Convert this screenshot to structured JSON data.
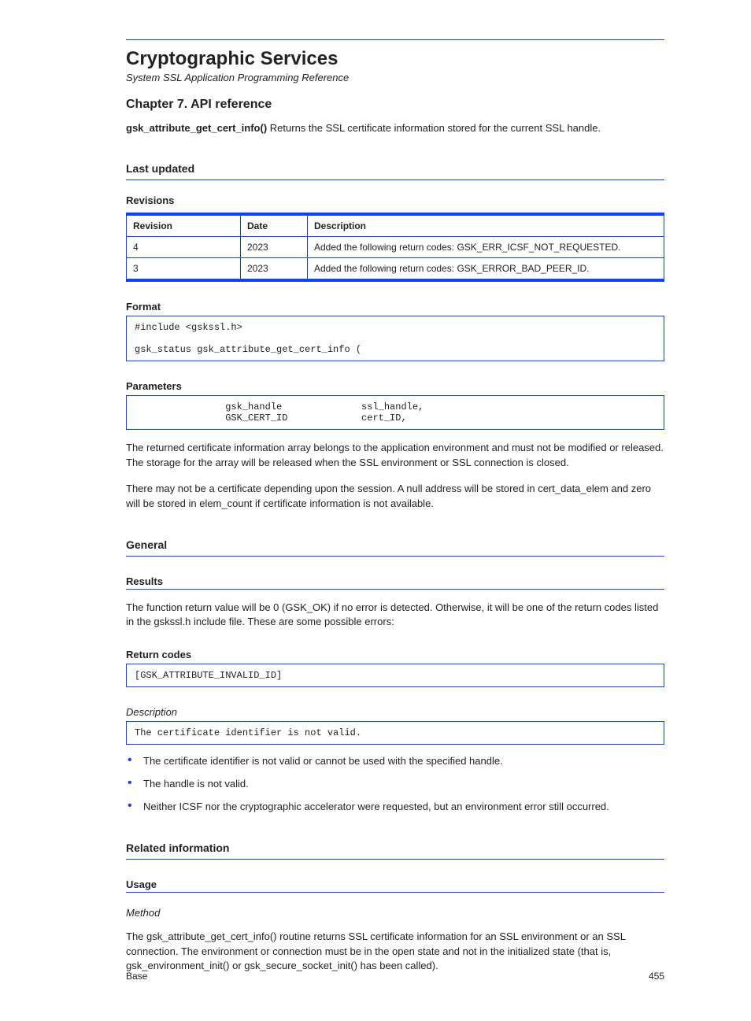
{
  "header": {
    "doc_title": "Cryptographic Services",
    "doc_subtitle": "System SSL Application Programming Reference",
    "chapter": "Chapter 7. API reference",
    "section_title": "gsk_attribute_get_cert_info()",
    "section_desc": "Returns the SSL certificate information stored for the current SSL handle."
  },
  "last_updated_heading": "Last updated",
  "revisions_caption": "Revisions",
  "revisions": {
    "headers": [
      "Revision",
      "Date",
      "Description"
    ],
    "rows": [
      [
        "4",
        "2023",
        "Added the following return codes: GSK_ERR_ICSF_NOT_REQUESTED."
      ],
      [
        "3",
        "2023",
        "Added the following return codes: GSK_ERROR_BAD_PEER_ID."
      ]
    ]
  },
  "format_label": "Format",
  "format_code": "#include <gskssl.h>\n\ngsk_status gsk_attribute_get_cert_info (",
  "format_params_label": "Parameters",
  "format_params_code": "                gsk_handle              ssl_handle,\n                GSK_CERT_ID             cert_ID,",
  "desc_para1": "The returned certificate information array belongs to the application environment and must not be modified or released. The storage for the array will be released when the SSL environment or SSL connection is closed.",
  "desc_para2": "There may not be a certificate depending upon the session. A null address will be stored in cert_data_elem and zero will be stored in elem_count if certificate information is not available.",
  "general_heading": "General",
  "results_heading": "Results",
  "function_return_para": "The function return value will be 0 (GSK_OK) if no error is detected. Otherwise, it will be one of the return codes listed in the gskssl.h include file. These are some possible errors:",
  "return_codes_label": "Return codes",
  "return_codes_code": "[GSK_ATTRIBUTE_INVALID_ID]",
  "notes": [
    "The certificate identifier is not valid or cannot be used with the specified handle.",
    "The handle is not valid.",
    "Neither ICSF nor the cryptographic accelerator were requested, but an environment error still occurred."
  ],
  "related_heading": "Related information",
  "usage_heading": "Usage",
  "method_label": "Method",
  "usage_para": "The gsk_attribute_get_cert_info() routine returns SSL certificate information for an SSL environment or an SSL connection. The environment or connection must be in the open state and not in the initialized state (that is, gsk_environment_init() or gsk_secure_socket_init() has been called).",
  "footer": {
    "left": "Base",
    "right": "455"
  }
}
